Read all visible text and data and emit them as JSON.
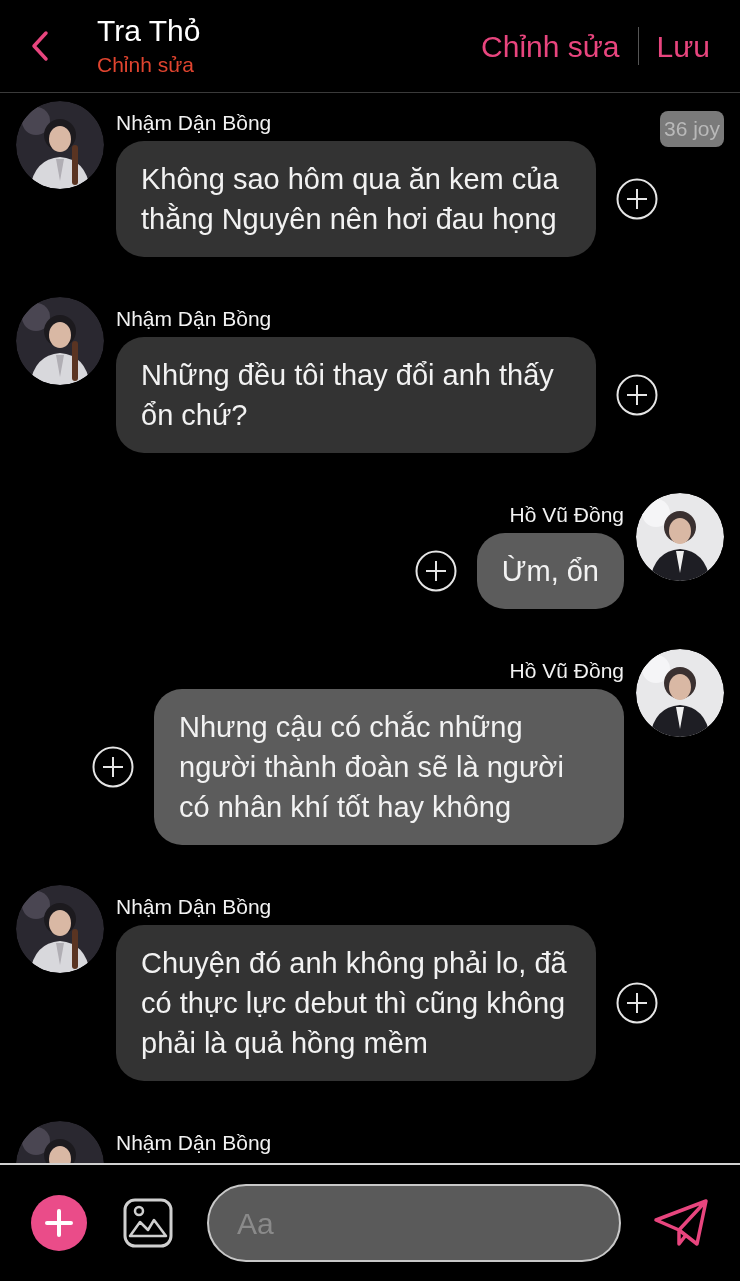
{
  "header": {
    "title": "Tra Thỏ",
    "subtitle": "Chỉnh sửa",
    "actions": [
      "Chỉnh sửa",
      "Lưu"
    ]
  },
  "messages": [
    {
      "kind": "incoming",
      "sender": "Nhậm Dận Bồng",
      "text": "Không sao hôm qua ăn kem của thằng Nguyên nên hơi đau họng",
      "badge": "36 joy"
    },
    {
      "kind": "incoming",
      "sender": "Nhậm Dận Bồng",
      "text": "Những đều tôi thay đổi anh thấy ổn chứ?"
    },
    {
      "kind": "outgoing",
      "sender": "Hồ Vũ Đồng",
      "text": "Ừm, ổn"
    },
    {
      "kind": "outgoing",
      "sender": "Hồ Vũ Đồng",
      "text": "Nhưng cậu có chắc những người thành đoàn sẽ là người có nhân khí tốt hay không"
    },
    {
      "kind": "incoming",
      "sender": "Nhậm Dận Bồng",
      "text": "Chuyện đó anh không phải lo, đã có thực lực debut thì cũng không phải là quả hồng mềm"
    },
    {
      "kind": "incoming",
      "sender": "Nhậm Dận Bồng"
    }
  ],
  "composer": {
    "placeholder": "Aa"
  }
}
